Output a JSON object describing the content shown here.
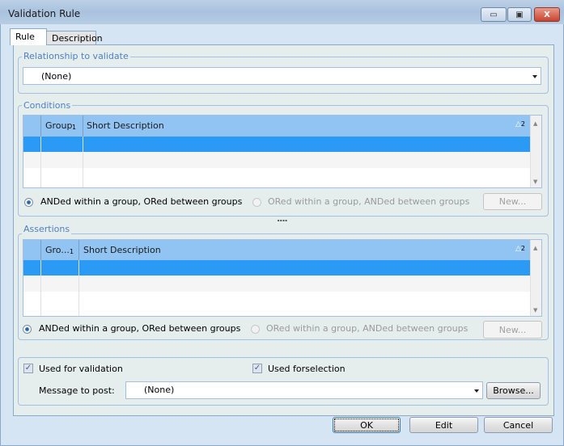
{
  "window": {
    "title": "Validation Rule",
    "minimize": "▭",
    "restore": "▣",
    "close": "X"
  },
  "tabs": [
    {
      "label": "Rule",
      "active": true
    },
    {
      "label": "Description",
      "active": false
    }
  ],
  "relationship": {
    "label": "Relationship to validate",
    "value": "(None)"
  },
  "conditions": {
    "label": "Conditions",
    "columns": [
      "Group",
      "Short Description"
    ],
    "sort_marks": [
      "1",
      "2"
    ],
    "radio_and": "ANDed within a group, ORed between groups",
    "radio_or": "ORed within a group, ANDed between groups",
    "new": "New..."
  },
  "splitter": "....",
  "assertions": {
    "label": "Assertions",
    "columns": [
      "Gro...",
      "Short Description"
    ],
    "sort_marks": [
      "1",
      "2"
    ],
    "radio_and": "ANDed within a group, ORed between groups",
    "radio_or": "ORed within a group, ANDed between groups",
    "new": "New..."
  },
  "options": {
    "used_validation": "Used for validation",
    "used_selection": "Used forselection",
    "message_label": "Message to post:",
    "message_value": "(None)",
    "browse": "Browse..."
  },
  "footer": {
    "ok": "OK",
    "edit": "Edit",
    "cancel": "Cancel"
  },
  "colors": {
    "header": "#92c4f3",
    "selected": "#2a9af5",
    "group_label": "#4e7fc2"
  }
}
